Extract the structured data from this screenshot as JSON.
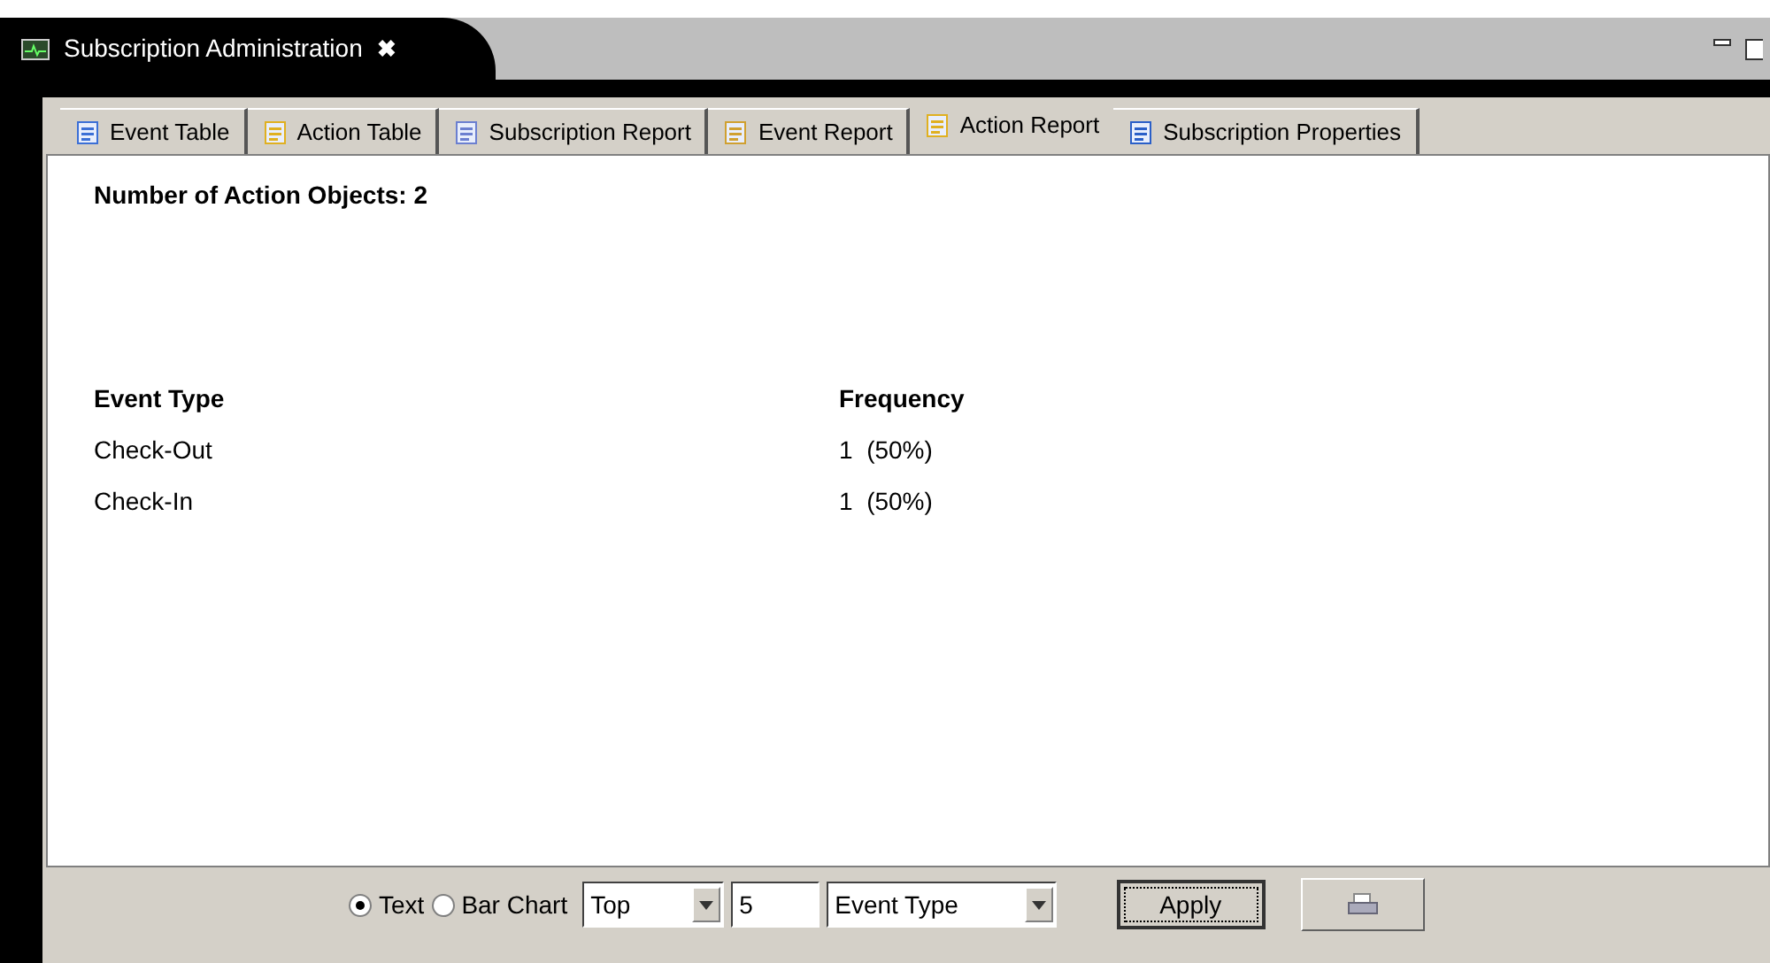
{
  "editor_tab": {
    "title": "Subscription Administration",
    "close": "✖"
  },
  "tabs": [
    {
      "label": "Event Table",
      "selected": false
    },
    {
      "label": "Action Table",
      "selected": false
    },
    {
      "label": "Subscription Report",
      "selected": false
    },
    {
      "label": "Event Report",
      "selected": false
    },
    {
      "label": "Action Report",
      "selected": true
    },
    {
      "label": "Subscription Properties",
      "selected": false
    }
  ],
  "summary": "Number of Action Objects: 2",
  "table": {
    "columns": [
      "Event Type",
      "Frequency"
    ],
    "rows": [
      [
        "Check-Out",
        "1  (50%)"
      ],
      [
        "Check-In",
        "1  (50%)"
      ]
    ]
  },
  "toolbar": {
    "view_options": [
      {
        "label": "Text",
        "selected": true
      },
      {
        "label": "Bar Chart",
        "selected": false
      }
    ],
    "range": "Top",
    "count": "5",
    "group_by": "Event Type",
    "apply": "Apply"
  }
}
